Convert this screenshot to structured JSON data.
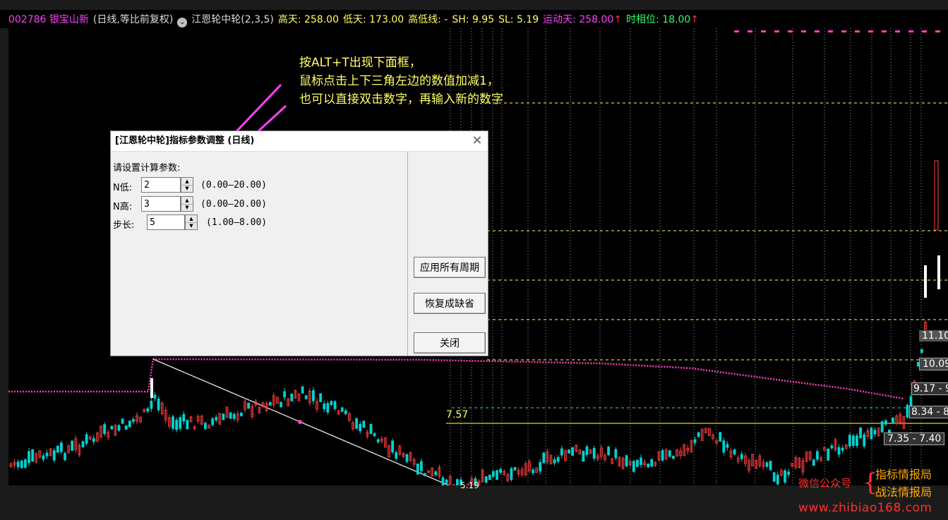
{
  "header": {
    "stock_code_name": "002786 银宝山新",
    "period_mode": "(日线,等比前复权)",
    "indicator_name": "江恩轮中轮(2,3,5)",
    "high_days": "高天: 258.00",
    "low_days": "低天: 173.00",
    "high_low_line": "高低线: -",
    "sh": "SH: 9.95",
    "sl": "SL: 5.19",
    "motion_days": "运动天: 258.00",
    "time_phase": "时相位: 18.00",
    "up_arrow": "↑"
  },
  "annotation": {
    "line1": "按ALT+T出现下面框，",
    "line2": "鼠标点击上下三角左边的数值加减1，",
    "line3": "也可以直接双击数字，再输入新的数字"
  },
  "dialog": {
    "title": "[江恩轮中轮]指标参数调整 (日线)",
    "close_symbol": "×",
    "prompt": "请设置计算参数:",
    "params": [
      {
        "label": "N低:",
        "value": "2",
        "range": "(0.00—20.00)"
      },
      {
        "label": "N高:",
        "value": "3",
        "range": "(0.00—20.00)"
      },
      {
        "label": "步长:",
        "value": "5",
        "range": "(1.00—8.00)"
      }
    ],
    "spin_up_symbol": "▲",
    "spin_down_symbol": "▼",
    "buttons": {
      "apply_all": "应用所有周期",
      "restore_default": "恢复成缺省",
      "close": "关闭"
    }
  },
  "price_labels": {
    "level_757": "7.57",
    "level_1110": "11.10",
    "level_1009": "10.09",
    "level_917": "9.17 - 9",
    "level_834": "8.34 - 8",
    "level_735": "7.35 - 7.40",
    "bottom_519": "5.19"
  },
  "watermark": {
    "wechat": "微信公众号",
    "brace": "{",
    "line1": "指标情报局",
    "line2": "战法情报局",
    "site": "www.zhibiao168.com"
  },
  "colors": {
    "background": "#000000",
    "frame": "#1b1b1b",
    "candle_up": "#ff4040",
    "candle_down": "#00d2d2",
    "gann_dotted": "#ff40c0",
    "level_dashed": "#ffff66",
    "trend_line": "#e6e6e6",
    "horizontal_757": "#dddd00",
    "arrow": "#ff40ff",
    "header_magenta": "#ff40ff",
    "header_yellow": "#ffff66",
    "header_green": "#33ff66",
    "header_white": "#dddddd"
  }
}
